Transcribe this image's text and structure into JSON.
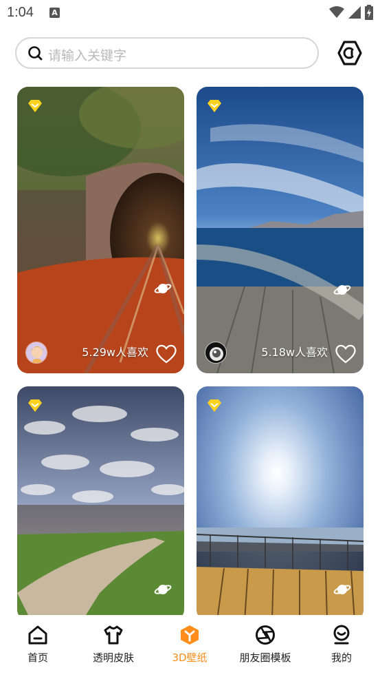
{
  "status_bar": {
    "time": "1:04",
    "notification_glyph": "A"
  },
  "search": {
    "placeholder": "请输入关键字"
  },
  "icons": {
    "search": "search-icon",
    "settings": "hexagon-settings-icon",
    "vip": "vip-diamond-icon",
    "planet": "planet-icon",
    "heart": "heart-icon"
  },
  "cards": [
    {
      "likes": "5.29w人喜欢",
      "avatar": "cartoon-girl-avatar"
    },
    {
      "likes": "5.18w人喜欢",
      "avatar": "astronaut-avatar"
    },
    {
      "likes": "",
      "avatar": ""
    },
    {
      "likes": "",
      "avatar": ""
    }
  ],
  "bottom_nav": [
    {
      "label": "首页",
      "icon": "home-icon",
      "active": false
    },
    {
      "label": "透明皮肤",
      "icon": "tshirt-icon",
      "active": false
    },
    {
      "label": "3D壁纸",
      "icon": "3d-wallpaper-icon",
      "active": true
    },
    {
      "label": "朋友圈模板",
      "icon": "shutter-icon",
      "active": false
    },
    {
      "label": "我的",
      "icon": "profile-icon",
      "active": false
    }
  ],
  "colors": {
    "accent": "#ff8d1a",
    "vip": "#ffd21f",
    "text": "#222222",
    "placeholder": "#b9b9b9"
  }
}
